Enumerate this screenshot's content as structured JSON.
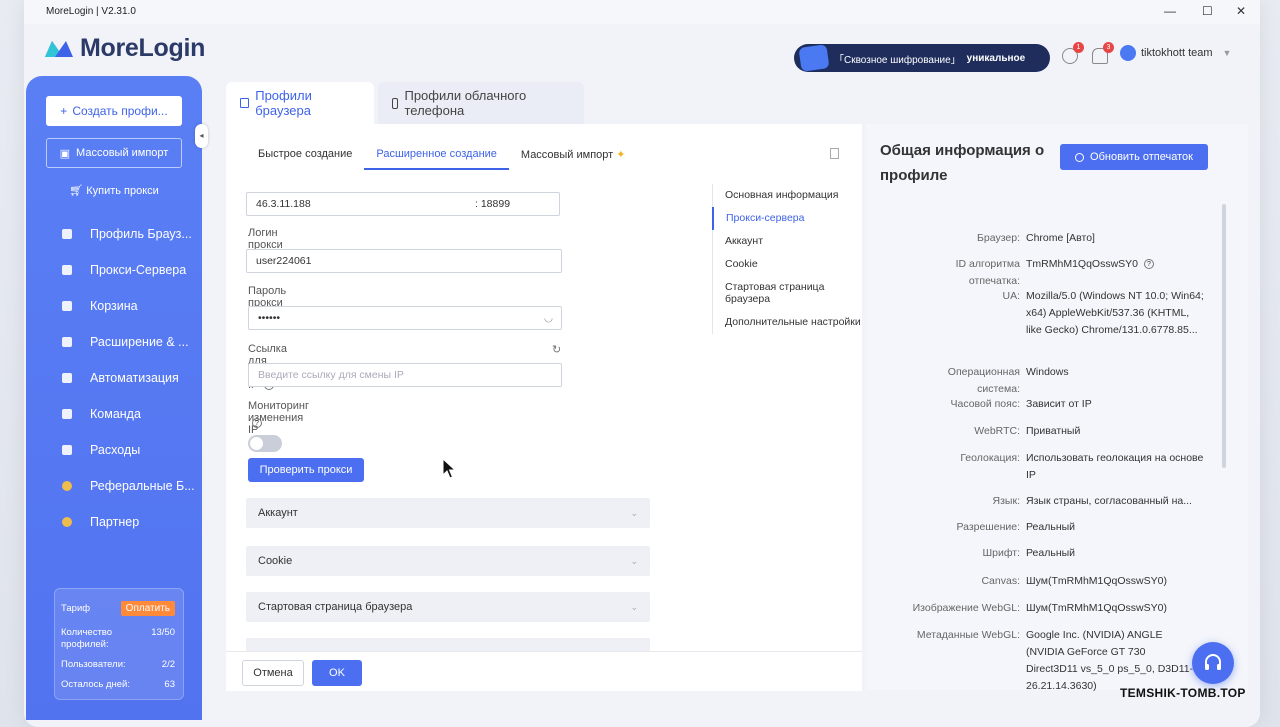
{
  "app": {
    "window_title": "MoreLogin | V2.31.0",
    "logo_text": "MoreLogin",
    "controls": {
      "minimize": "—",
      "maximize": "☐",
      "close": "✕"
    }
  },
  "header": {
    "encryption_left": "「Сквозное шифрование」",
    "encryption_right": "уникальное",
    "help_badge": "1",
    "notif_badge": "3",
    "user_name": "tiktokhott team"
  },
  "sidebar": {
    "create_label": "Создать профи...",
    "import_label": "Массовый импорт",
    "buy_proxy": "Купить прокси",
    "items": [
      {
        "label": "Профиль Брауз...",
        "icon": "browser-icon"
      },
      {
        "label": "Прокси-Сервера",
        "icon": "server-icon"
      },
      {
        "label": "Корзина",
        "icon": "trash-icon"
      },
      {
        "label": "Расширение & ...",
        "icon": "puzzle-icon"
      },
      {
        "label": "Автоматизация",
        "icon": "robot-icon"
      },
      {
        "label": "Команда",
        "icon": "team-icon"
      },
      {
        "label": "Расходы",
        "icon": "wallet-icon"
      },
      {
        "label": "Реферальные Б...",
        "icon": "coin-icon"
      },
      {
        "label": "Партнер",
        "icon": "heart-icon"
      }
    ],
    "plan": {
      "tariff_label": "Тариф",
      "pay_label": "Оплатить",
      "profiles_label": "Количество профилей:",
      "profiles_value": "13/50",
      "users_label": "Пользователи:",
      "users_value": "2/2",
      "days_label": "Осталось дней:",
      "days_value": "63"
    }
  },
  "tabs": {
    "browser_profiles": "Профили браузера",
    "cloud_phone": "Профили облачного телефона"
  },
  "subtabs": {
    "quick": "Быстрое создание",
    "advanced": "Расширенное создание",
    "bulk": "Массовый импорт",
    "bulk_star": "✦"
  },
  "form": {
    "host_value": "46.3.11.188",
    "port_value": ": 18899",
    "login_label": "Логин прокси",
    "login_value": "user224061",
    "password_label": "Пароль прокси",
    "password_value": "••••••",
    "ip_change_label": "Ссылка для смены IP",
    "ip_change_placeholder": "Введите ссылку для смены IP",
    "monitor_label": "Мониторинг изменения IP",
    "check_proxy": "Проверить прокси",
    "sections": [
      "Аккаунт",
      "Cookie",
      "Стартовая страница браузера"
    ],
    "cancel": "Отмена",
    "ok": "OK"
  },
  "anchors": [
    "Основная информация",
    "Прокси-сервера",
    "Аккаунт",
    "Cookie",
    "Стартовая страница браузера",
    "Дополнительные настройки"
  ],
  "summary": {
    "title": "Общая информация о профиле",
    "refresh_label": "Обновить отпечаток",
    "rows": [
      {
        "key": "Браузер:",
        "value": "Chrome [Авто]"
      },
      {
        "key": "ID алгоритма отпечатка:",
        "value": "TmRMhM1QqOsswSY0"
      },
      {
        "key": "UA:",
        "value": "Mozilla/5.0 (Windows NT 10.0; Win64; x64) AppleWebKit/537.36 (KHTML, like Gecko) Chrome/131.0.6778.85..."
      },
      {
        "key": "Операционная система:",
        "value": "Windows"
      },
      {
        "key": "Часовой пояс:",
        "value": "Зависит от IP"
      },
      {
        "key": "WebRTC:",
        "value": "Приватный"
      },
      {
        "key": "Геолокация:",
        "value": "Использовать геолокация на основе IP"
      },
      {
        "key": "Язык:",
        "value": "Язык страны, согласованный на..."
      },
      {
        "key": "Разрешение:",
        "value": "Реальный"
      },
      {
        "key": "Шрифт:",
        "value": "Реальный"
      },
      {
        "key": "Canvas:",
        "value": "Шум(TmRMhM1QqOsswSY0)"
      },
      {
        "key": "Изображение WebGL:",
        "value": "Шум(TmRMhM1QqOsswSY0)"
      },
      {
        "key": "Метаданные WebGL:",
        "value": "Google Inc. (NVIDIA) ANGLE (NVIDIA GeForce GT 730 Direct3D11 vs_5_0 ps_5_0, D3D11-26.21.14.3630)"
      }
    ]
  },
  "watermark": "TEMSHIK-TOMB.TOP",
  "colors": {
    "accent": "#4b6ff0",
    "sidebar": "#5a7ff5",
    "pay": "#ff8a3a",
    "brand_dark": "#2b3a67"
  }
}
